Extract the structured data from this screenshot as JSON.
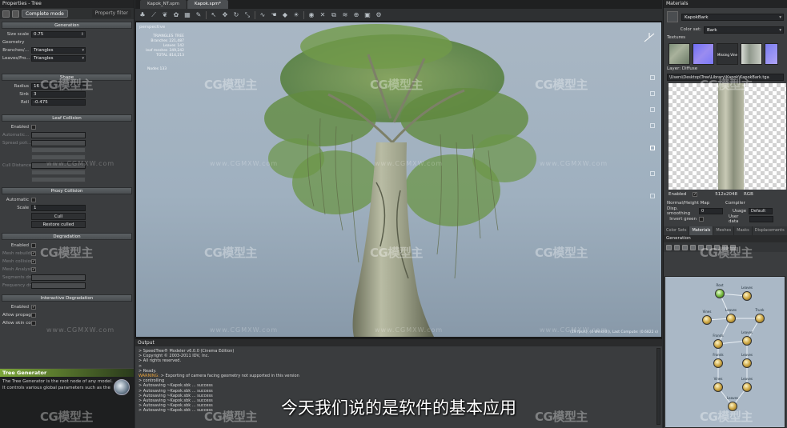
{
  "left_panel": {
    "title": "Properties - Tree",
    "mode": "Complete mode",
    "filter": "Property filter",
    "sections": {
      "generation": "Generation",
      "shape": "Shape",
      "leaf_collision": "Leaf Collision",
      "proxy_collision": "Proxy Collision",
      "degradation": "Degradation",
      "interactive_degradation": "Interactive Degradation"
    },
    "size_scale": {
      "label": "Size scale",
      "value": "0.75"
    },
    "geometry_label": "Geometry",
    "branches": {
      "label": "Branches/...",
      "value": "Triangles"
    },
    "leaves": {
      "label": "Leaves/Fro...",
      "value": "Triangles"
    },
    "radius": {
      "label": "Radius",
      "value": "16"
    },
    "sink": {
      "label": "Sink",
      "value": "3"
    },
    "roll": {
      "label": "Roll",
      "value": "-0.475"
    },
    "leaf_enabled": "Enabled",
    "leaf_dim_labels": [
      "Automatic...",
      "Spread poli...",
      "Cull Distance"
    ],
    "proxy_automatic": "Automatic",
    "proxy_scale": {
      "label": "Scale",
      "value": "1"
    },
    "cull_button": "Cull",
    "restore_button": "Restore culled",
    "degradation_enabled": "Enabled",
    "degradation_dim_labels": [
      "Mesh rebuilding",
      "Mesh collision",
      "Mesh Analysis",
      "Segments dro...",
      "Frequency dr..."
    ],
    "interactive_enabled": "Enabled",
    "allow_propag": "Allow propag...",
    "allow_skin": "Allow skin co...",
    "help_title": "Tree Generator",
    "help_text": "The Tree Generator is the root node of any model. It controls various global parameters such as the"
  },
  "tabs": [
    {
      "label": "Kapok_NT.spm"
    },
    {
      "label": "Kapok.spm*"
    }
  ],
  "viewport": {
    "label": "perspective",
    "stats": [
      {
        "k": "TRIANGLES",
        "v": "TREE"
      },
      {
        "k": "Branches",
        "v": "221,487"
      },
      {
        "k": "Leaves",
        "v": "142"
      },
      {
        "k": "leaf meshes",
        "v": "349,242"
      },
      {
        "k": "TOTAL",
        "v": "814,213"
      }
    ],
    "stats_extra": "Nodes 133",
    "status_line": "(19 fps/s), (4 Wind(0)), Last Compute: (0.6822 s)"
  },
  "output": {
    "title": "Output",
    "lines": [
      "> SpeedTree® Modeler v6.0.0 (Cinema Edition)",
      "> Copyright © 2003-2011 IDV, Inc.",
      "> All rights reserved.",
      ">",
      "> Ready.",
      "> Exporting of camera facing geometry not supported in this version",
      "> controlling",
      "> Autosaving ~Kapok.sbk ... success",
      "> Autosaving ~Kapok.sbk ... success",
      "> Autosaving ~Kapok.sbk ... success",
      "> Autosaving ~Kapok.sbk ... success",
      "> Autosaving ~Kapok.sbk ... success",
      "> Autosaving ~Kapok.sbk ... success"
    ],
    "warn_tag": "WARNING:"
  },
  "subtitle": "今天我们说的是软件的基本应用",
  "right_panel": {
    "title": "Materials",
    "material_name": "KapokBark",
    "color_set": {
      "label": "Color set:",
      "value": "Bark"
    },
    "textures_label": "Textures",
    "vine_thumb": "Missing Vine",
    "layer_label": "Layer: Diffuse",
    "path": "\\Users\\Desktop\\Tree\\Library\\Kapok\\KapokBark.tga",
    "enabled_label": "Enabled",
    "enabled_check": "✓",
    "resolution": "512x2048",
    "format": "RGB",
    "normal_map_label": "Normal/Height Map",
    "compiler_label": "Compiler",
    "disp_smoothing": {
      "label": "Disp. smoothing",
      "value": "0"
    },
    "usage": {
      "label": "Usage",
      "value": "Default"
    },
    "invert_green": "Invert green",
    "user_data": "User data",
    "tabs": [
      "Color Sets",
      "Materials",
      "Meshes",
      "Masks",
      "Displacements"
    ],
    "generation_title": "Generation",
    "nodes": [
      {
        "label": "Root"
      },
      {
        "label": "Leaves"
      },
      {
        "label": "Vines"
      },
      {
        "label": "Leaves"
      },
      {
        "label": "Trunk"
      },
      {
        "label": "Fronds"
      },
      {
        "label": "Leaves"
      },
      {
        "label": "Fronds"
      },
      {
        "label": "Leaves"
      },
      {
        "label": "Vines"
      },
      {
        "label": "Leaves"
      },
      {
        "label": "Leaves"
      }
    ]
  },
  "watermark": {
    "brand": "CG模型主",
    "url": "www.CGMXW.com"
  },
  "colors": {
    "help_accent": "#7ca63a",
    "warning": "#e6a23c",
    "sky": "#a9b7c4",
    "panel": "#3b3d3f"
  },
  "icons": [
    "cursor-icon",
    "camera-icon",
    "rotate-icon",
    "zoom-icon",
    "light-icon",
    "wind-icon",
    "help-globe-icon"
  ]
}
